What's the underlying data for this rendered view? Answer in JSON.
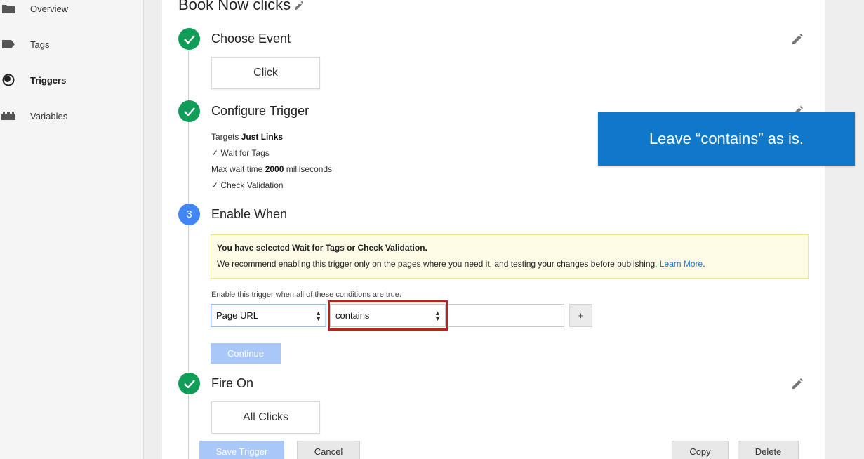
{
  "sidebar": {
    "items": [
      {
        "label": "Overview",
        "icon": "folder-icon"
      },
      {
        "label": "Tags",
        "icon": "tag-icon"
      },
      {
        "label": "Triggers",
        "icon": "trigger-icon",
        "active": true
      },
      {
        "label": "Variables",
        "icon": "variables-icon"
      }
    ]
  },
  "page": {
    "title": "Book Now clicks"
  },
  "steps": {
    "choose_event": {
      "title": "Choose Event",
      "value": "Click"
    },
    "configure_trigger": {
      "title": "Configure Trigger",
      "targets_prefix": "Targets",
      "targets_value": "Just Links",
      "wait_for_tags": "Wait for Tags",
      "max_wait_prefix": "Max wait time",
      "max_wait_value": "2000",
      "max_wait_suffix": "milliseconds",
      "check_validation": "Check Validation"
    },
    "enable_when": {
      "number": "3",
      "title": "Enable When",
      "warning_title": "You have selected Wait for Tags or Check Validation.",
      "warning_text": "We recommend enabling this trigger only on the pages where you need it, and testing your changes before publishing.",
      "warning_link": "Learn More",
      "warning_end": ".",
      "conditions_label": "Enable this trigger when all of these conditions are true.",
      "variable_select": "Page URL",
      "operator_select": "contains",
      "value_input": "",
      "plus_label": "+",
      "continue_label": "Continue"
    },
    "fire_on": {
      "title": "Fire On",
      "value": "All Clicks"
    }
  },
  "footer": {
    "save_label": "Save Trigger",
    "cancel_label": "Cancel",
    "copy_label": "Copy",
    "delete_label": "Delete"
  },
  "callout": {
    "text": "Leave “contains” as is."
  },
  "colors": {
    "done": "#0f9d58",
    "current": "#4285f4",
    "highlight": "#b3261e",
    "callout": "#0f78c8",
    "link": "#1a73e8"
  }
}
